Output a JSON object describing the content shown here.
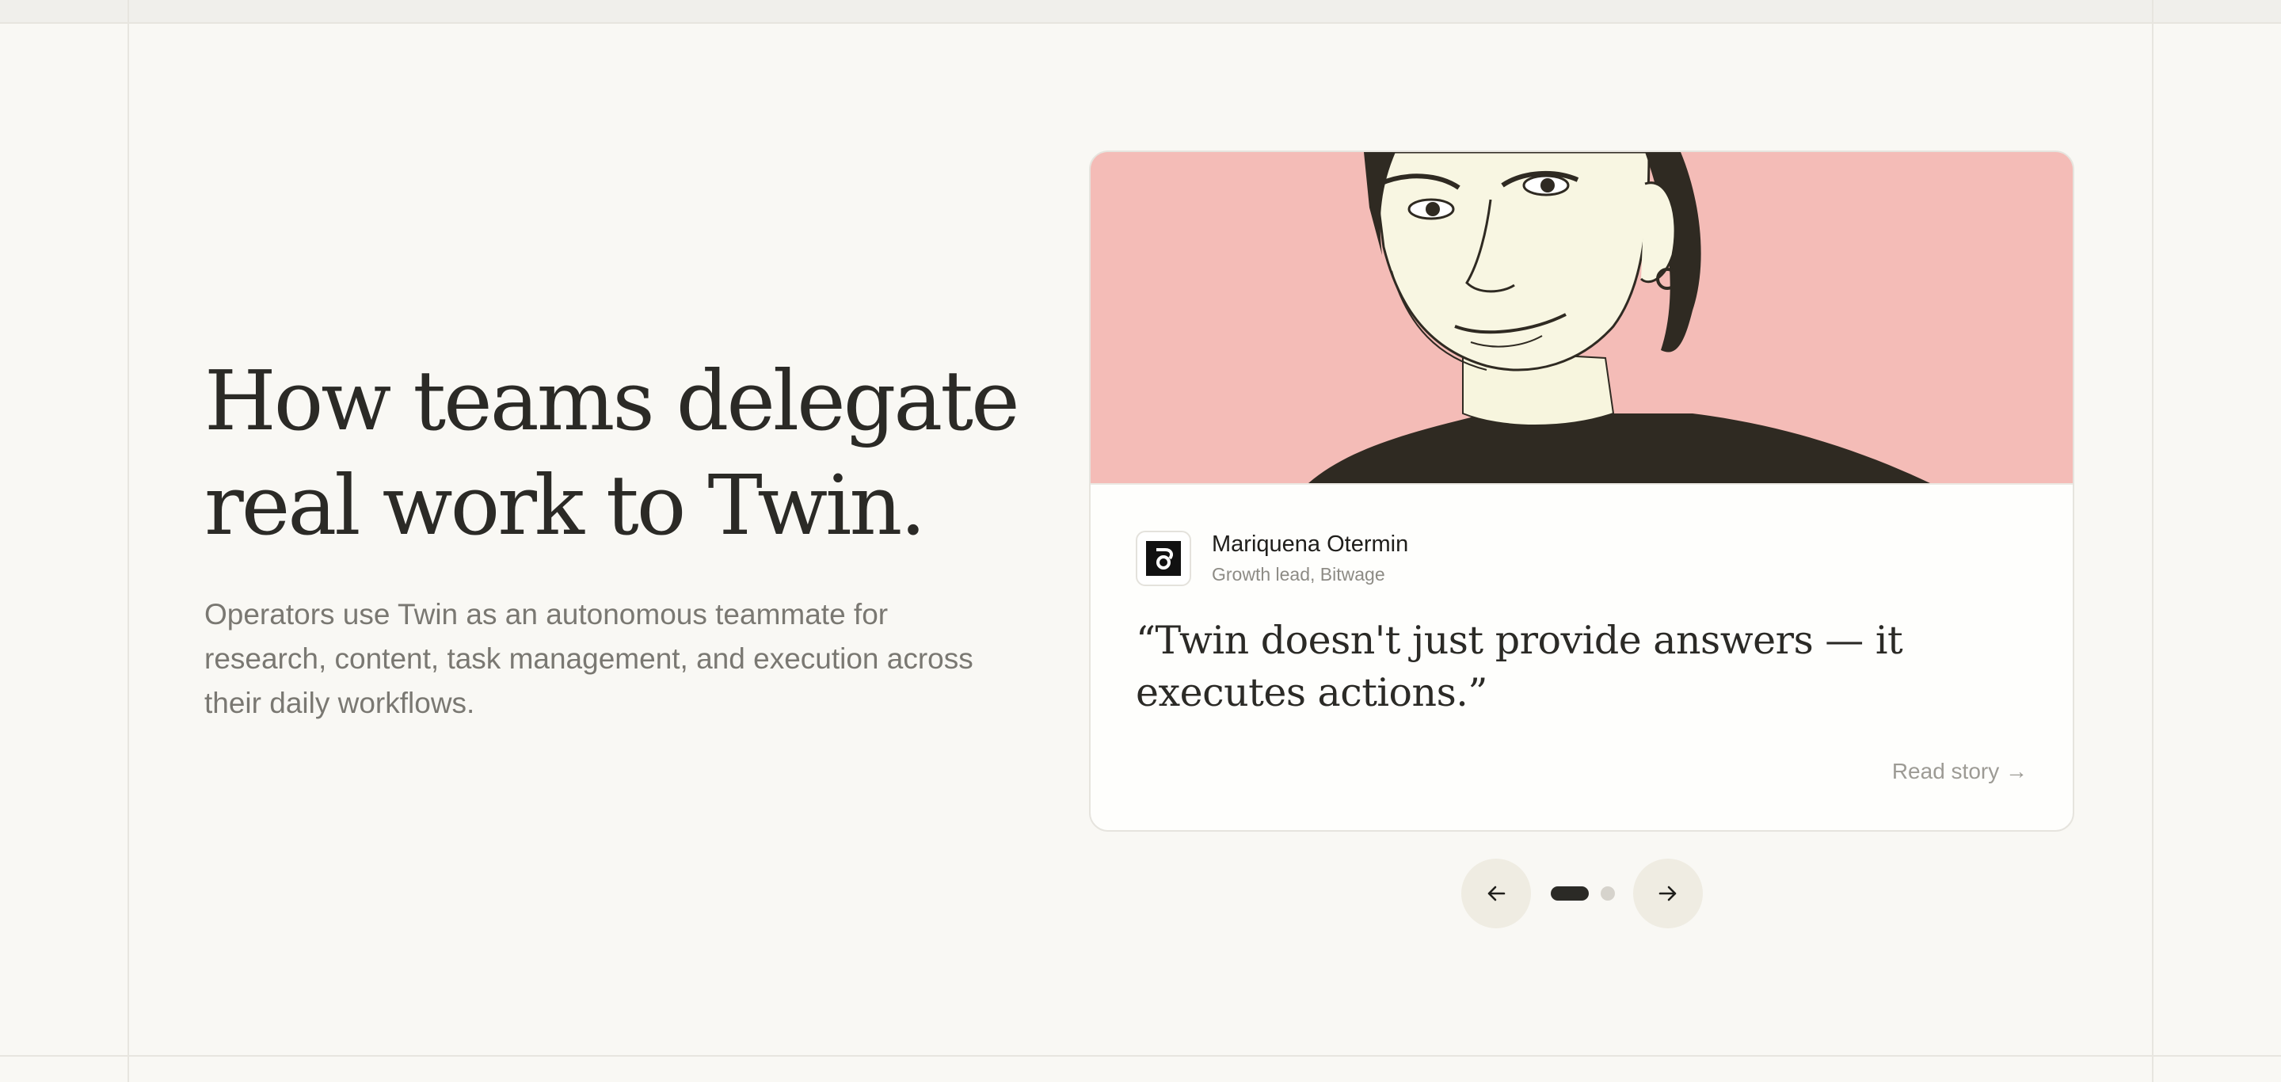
{
  "hero": {
    "headline_line1": "How teams delegate",
    "headline_line2": "real work to Twin.",
    "intro": "Operators use Twin as an autonomous teammate for research, content, task management, and execution across their daily workflows."
  },
  "testimonial": {
    "author_name": "Mariquena Otermin",
    "author_role": "Growth lead, Bitwage",
    "quote": "“Twin doesn't just provide answers — it executes actions.”",
    "read_story_label": "Read story →",
    "portrait_background": "#f4bcb7"
  },
  "carousel": {
    "prev_icon": "arrow-left-icon",
    "next_icon": "arrow-right-icon",
    "slide_count": 2,
    "active_index": 0
  },
  "colors": {
    "page_background": "#f9f8f4",
    "text": "#2b2a26",
    "muted_text": "#7a7872",
    "nav_button": "#efece2"
  }
}
